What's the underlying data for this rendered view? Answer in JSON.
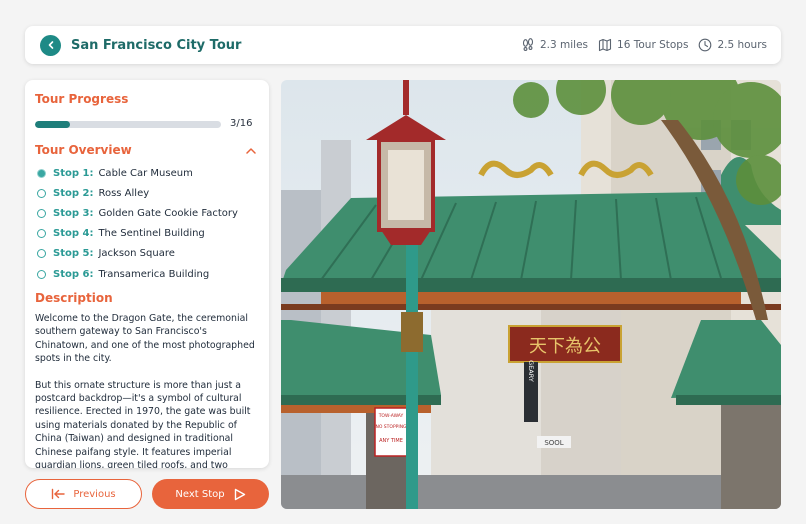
{
  "header": {
    "title": "San Francisco City Tour",
    "distance": "2.3 miles",
    "stops": "16 Tour Stops",
    "duration": "2.5 hours",
    "icons": [
      "back-arrow-icon",
      "footprints-icon",
      "map-icon",
      "clock-icon"
    ]
  },
  "progress": {
    "title": "Tour Progress",
    "current": 3,
    "total": 16,
    "label": "3/16"
  },
  "overview": {
    "title": "Tour Overview",
    "stops": [
      {
        "label": "Stop 1:",
        "name": "Cable Car Museum",
        "done": true
      },
      {
        "label": "Stop 2:",
        "name": "Ross Alley",
        "done": false
      },
      {
        "label": "Stop 3:",
        "name": "Golden Gate Cookie Factory",
        "done": false
      },
      {
        "label": "Stop 4:",
        "name": "The Sentinel Building",
        "done": false
      },
      {
        "label": "Stop 5:",
        "name": "Jackson Square",
        "done": false
      },
      {
        "label": "Stop 6:",
        "name": "Transamerica Building",
        "done": false
      }
    ]
  },
  "description": {
    "title": "Description",
    "p1": "Welcome to the Dragon Gate, the ceremonial southern gateway to San Francisco's Chinatown, and one of the most photographed spots in the city.",
    "p2": "But this ornate structure is more than just a postcard backdrop—it's a symbol of cultural resilience. Erected in 1970, the gate was built using materials donated by the Republic of China (Taiwan) and designed in traditional Chinese paifang style. It features imperial guardian lions, green tiled roofs, and two"
  },
  "buttons": {
    "previous": "Previous",
    "next": "Next Stop"
  },
  "photo": {
    "sign_text": "天下為公",
    "street_sign": "GEARY",
    "tow_sign_1": "TOW-AWAY",
    "tow_sign_2": "NO STOPPING",
    "tow_sign_3": "ANY TIME",
    "store_sign": "SOOL"
  },
  "colors": {
    "accent": "#e8643c",
    "teal": "#1e8a86",
    "roof_green": "#3f8e6e"
  }
}
